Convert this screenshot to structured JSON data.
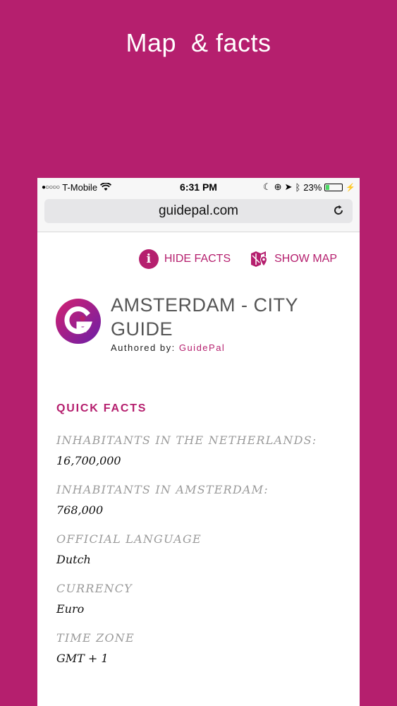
{
  "promo": {
    "title": "Map  & facts"
  },
  "status_bar": {
    "carrier": "T-Mobile",
    "signal_dots": "●○○○○",
    "time": "6:31 PM",
    "battery_percent": "23%",
    "battery_level": 0.23
  },
  "browser": {
    "url": "guidepal.com"
  },
  "actions": {
    "hide_facts": "HIDE FACTS",
    "show_map": "SHOW MAP"
  },
  "guide": {
    "title": "AMSTERDAM - CITY GUIDE",
    "authored_prefix": "Authored by:",
    "author": "GuidePal"
  },
  "quick_facts": {
    "heading": "QUICK FACTS",
    "items": [
      {
        "label": "INHABITANTS IN THE NETHERLANDS:",
        "value": "16,700,000"
      },
      {
        "label": "INHABITANTS IN AMSTERDAM:",
        "value": "768,000"
      },
      {
        "label": "OFFICIAL LANGUAGE",
        "value": "Dutch"
      },
      {
        "label": "CURRENCY",
        "value": "Euro"
      },
      {
        "label": "TIME ZONE",
        "value": "GMT + 1"
      }
    ]
  },
  "colors": {
    "brand": "#B51F6E",
    "battery": "#4cd964"
  }
}
